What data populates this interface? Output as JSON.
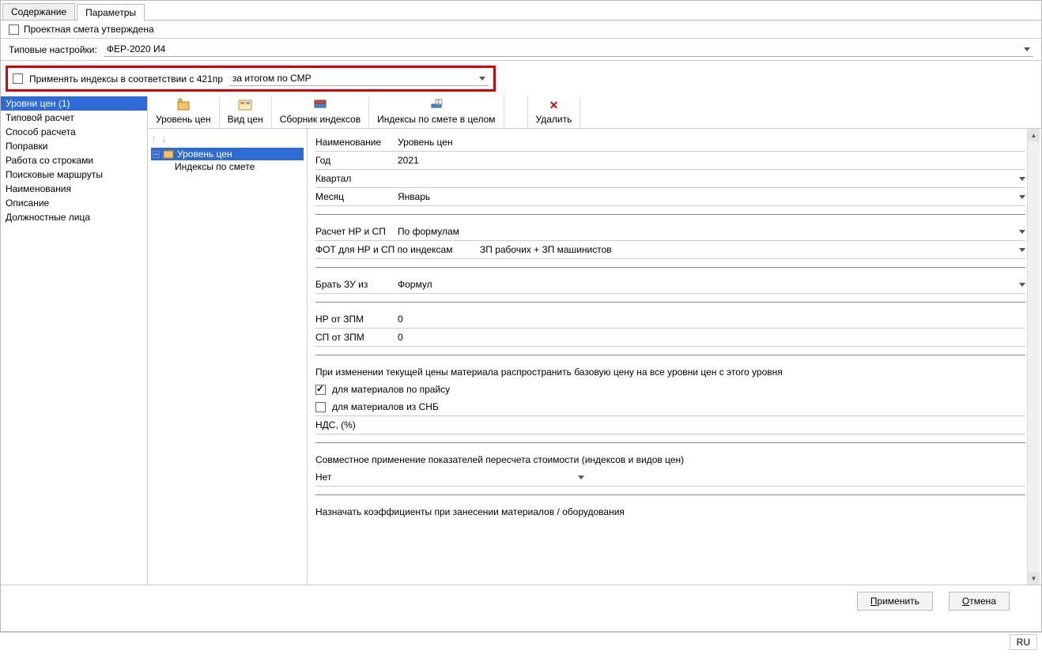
{
  "tabs": {
    "content": "Содержание",
    "params": "Параметры"
  },
  "approved_label": "Проектная смета утверждена",
  "typerow": {
    "label": "Типовые настройки:",
    "value": "ФЕР-2020 И4"
  },
  "highlight": {
    "chk_label": "Применять индексы в соответствии с 421пр",
    "combo_value": "за итогом по СМР"
  },
  "sidebar": {
    "items": [
      "Уровни цен (1)",
      "Типовой расчет",
      "Способ расчета",
      "Поправки",
      "Работа со строками",
      "Поисковые маршруты",
      "Наименования",
      "Описание",
      "Должностные лица"
    ]
  },
  "toolbar": {
    "level": "Уровень цен",
    "view": "Вид цен",
    "collection": "Сборник индексов",
    "indices": "Индексы по смете в целом",
    "delete": "Удалить"
  },
  "tree": {
    "root": "Уровень цен",
    "child": "Индексы по смете"
  },
  "form": {
    "name_label": "Наименование",
    "name_value": "Уровень цен",
    "year_label": "Год",
    "year_value": "2021",
    "quarter_label": "Квартал",
    "quarter_value": "",
    "month_label": "Месяц",
    "month_value": "Январь",
    "calc_label": "Расчет НР и СП",
    "calc_value": "По формулам",
    "fot_label": "ФОТ для НР и СП по индексам",
    "fot_value": "ЗП рабочих + ЗП машинистов",
    "zu_label": "Брать ЗУ из",
    "zu_value": "Формул",
    "nr_label": "НР от ЗПМ",
    "nr_value": "0",
    "sp_label": "СП от ЗПМ",
    "sp_value": "0",
    "spread_label": "При изменении текущей цены материала распространить базовую цену на все уровни цен с этого уровня",
    "mat_price": "для материалов по прайсу",
    "mat_snb": "для материалов из СНБ",
    "nds_label": "НДС, (%)",
    "nds_value": "",
    "joint_label": "Совместное применение показателей пересчета стоимости (индексов и видов цен)",
    "joint_value": "Нет",
    "assign_label": "Назначать коэффициенты при занесении материалов / оборудования"
  },
  "buttons": {
    "apply": "Применить",
    "cancel": "Отмена"
  },
  "status": {
    "lang": "RU"
  }
}
